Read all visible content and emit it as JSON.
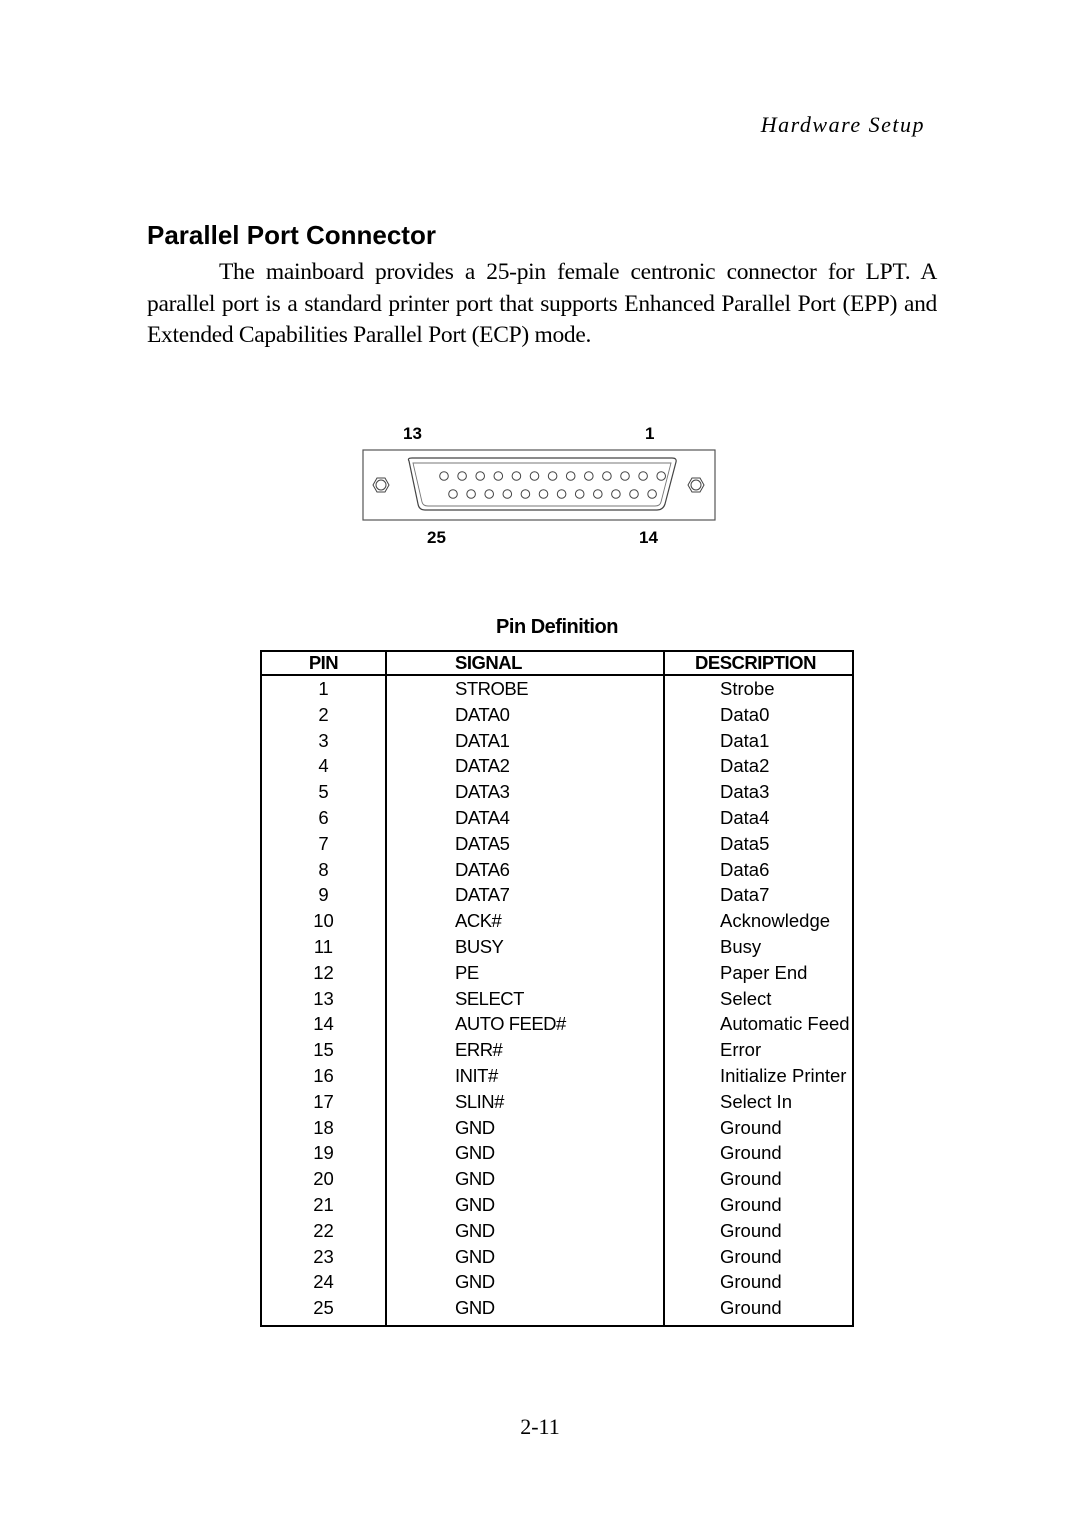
{
  "header": {
    "running_title": "Hardware Setup"
  },
  "section": {
    "title": "Parallel Port Connector",
    "intro": "The mainboard provides a 25-pin female centronic connector for LPT. A parallel port is a standard printer port that supports Enhanced Parallel Port (EPP) and Extended Capabilities Parallel Port (ECP) mode."
  },
  "connector": {
    "labels": {
      "top_left": "13",
      "top_right": "1",
      "bottom_left": "25",
      "bottom_right": "14"
    },
    "top_row_pins": 13,
    "bottom_row_pins": 12
  },
  "pin_table": {
    "caption": "Pin Definition",
    "headers": [
      "PIN",
      "SIGNAL",
      "DESCRIPTION"
    ],
    "rows": [
      [
        "1",
        "STROBE",
        "Strobe"
      ],
      [
        "2",
        "DATA0",
        "Data0"
      ],
      [
        "3",
        "DATA1",
        "Data1"
      ],
      [
        "4",
        "DATA2",
        "Data2"
      ],
      [
        "5",
        "DATA3",
        "Data3"
      ],
      [
        "6",
        "DATA4",
        "Data4"
      ],
      [
        "7",
        "DATA5",
        "Data5"
      ],
      [
        "8",
        "DATA6",
        "Data6"
      ],
      [
        "9",
        "DATA7",
        "Data7"
      ],
      [
        "10",
        "ACK#",
        "Acknowledge"
      ],
      [
        "11",
        "BUSY",
        "Busy"
      ],
      [
        "12",
        "PE",
        "Paper End"
      ],
      [
        "13",
        "SELECT",
        "Select"
      ],
      [
        "14",
        "AUTO FEED#",
        "Automatic Feed"
      ],
      [
        "15",
        "ERR#",
        "Error"
      ],
      [
        "16",
        "INIT#",
        "Initialize Printer"
      ],
      [
        "17",
        "SLIN#",
        "Select In"
      ],
      [
        "18",
        "GND",
        "Ground"
      ],
      [
        "19",
        "GND",
        "Ground"
      ],
      [
        "20",
        "GND",
        "Ground"
      ],
      [
        "21",
        "GND",
        "Ground"
      ],
      [
        "22",
        "GND",
        "Ground"
      ],
      [
        "23",
        "GND",
        "Ground"
      ],
      [
        "24",
        "GND",
        "Ground"
      ],
      [
        "25",
        "GND",
        "Ground"
      ]
    ]
  },
  "footer": {
    "page_number": "2-11"
  }
}
